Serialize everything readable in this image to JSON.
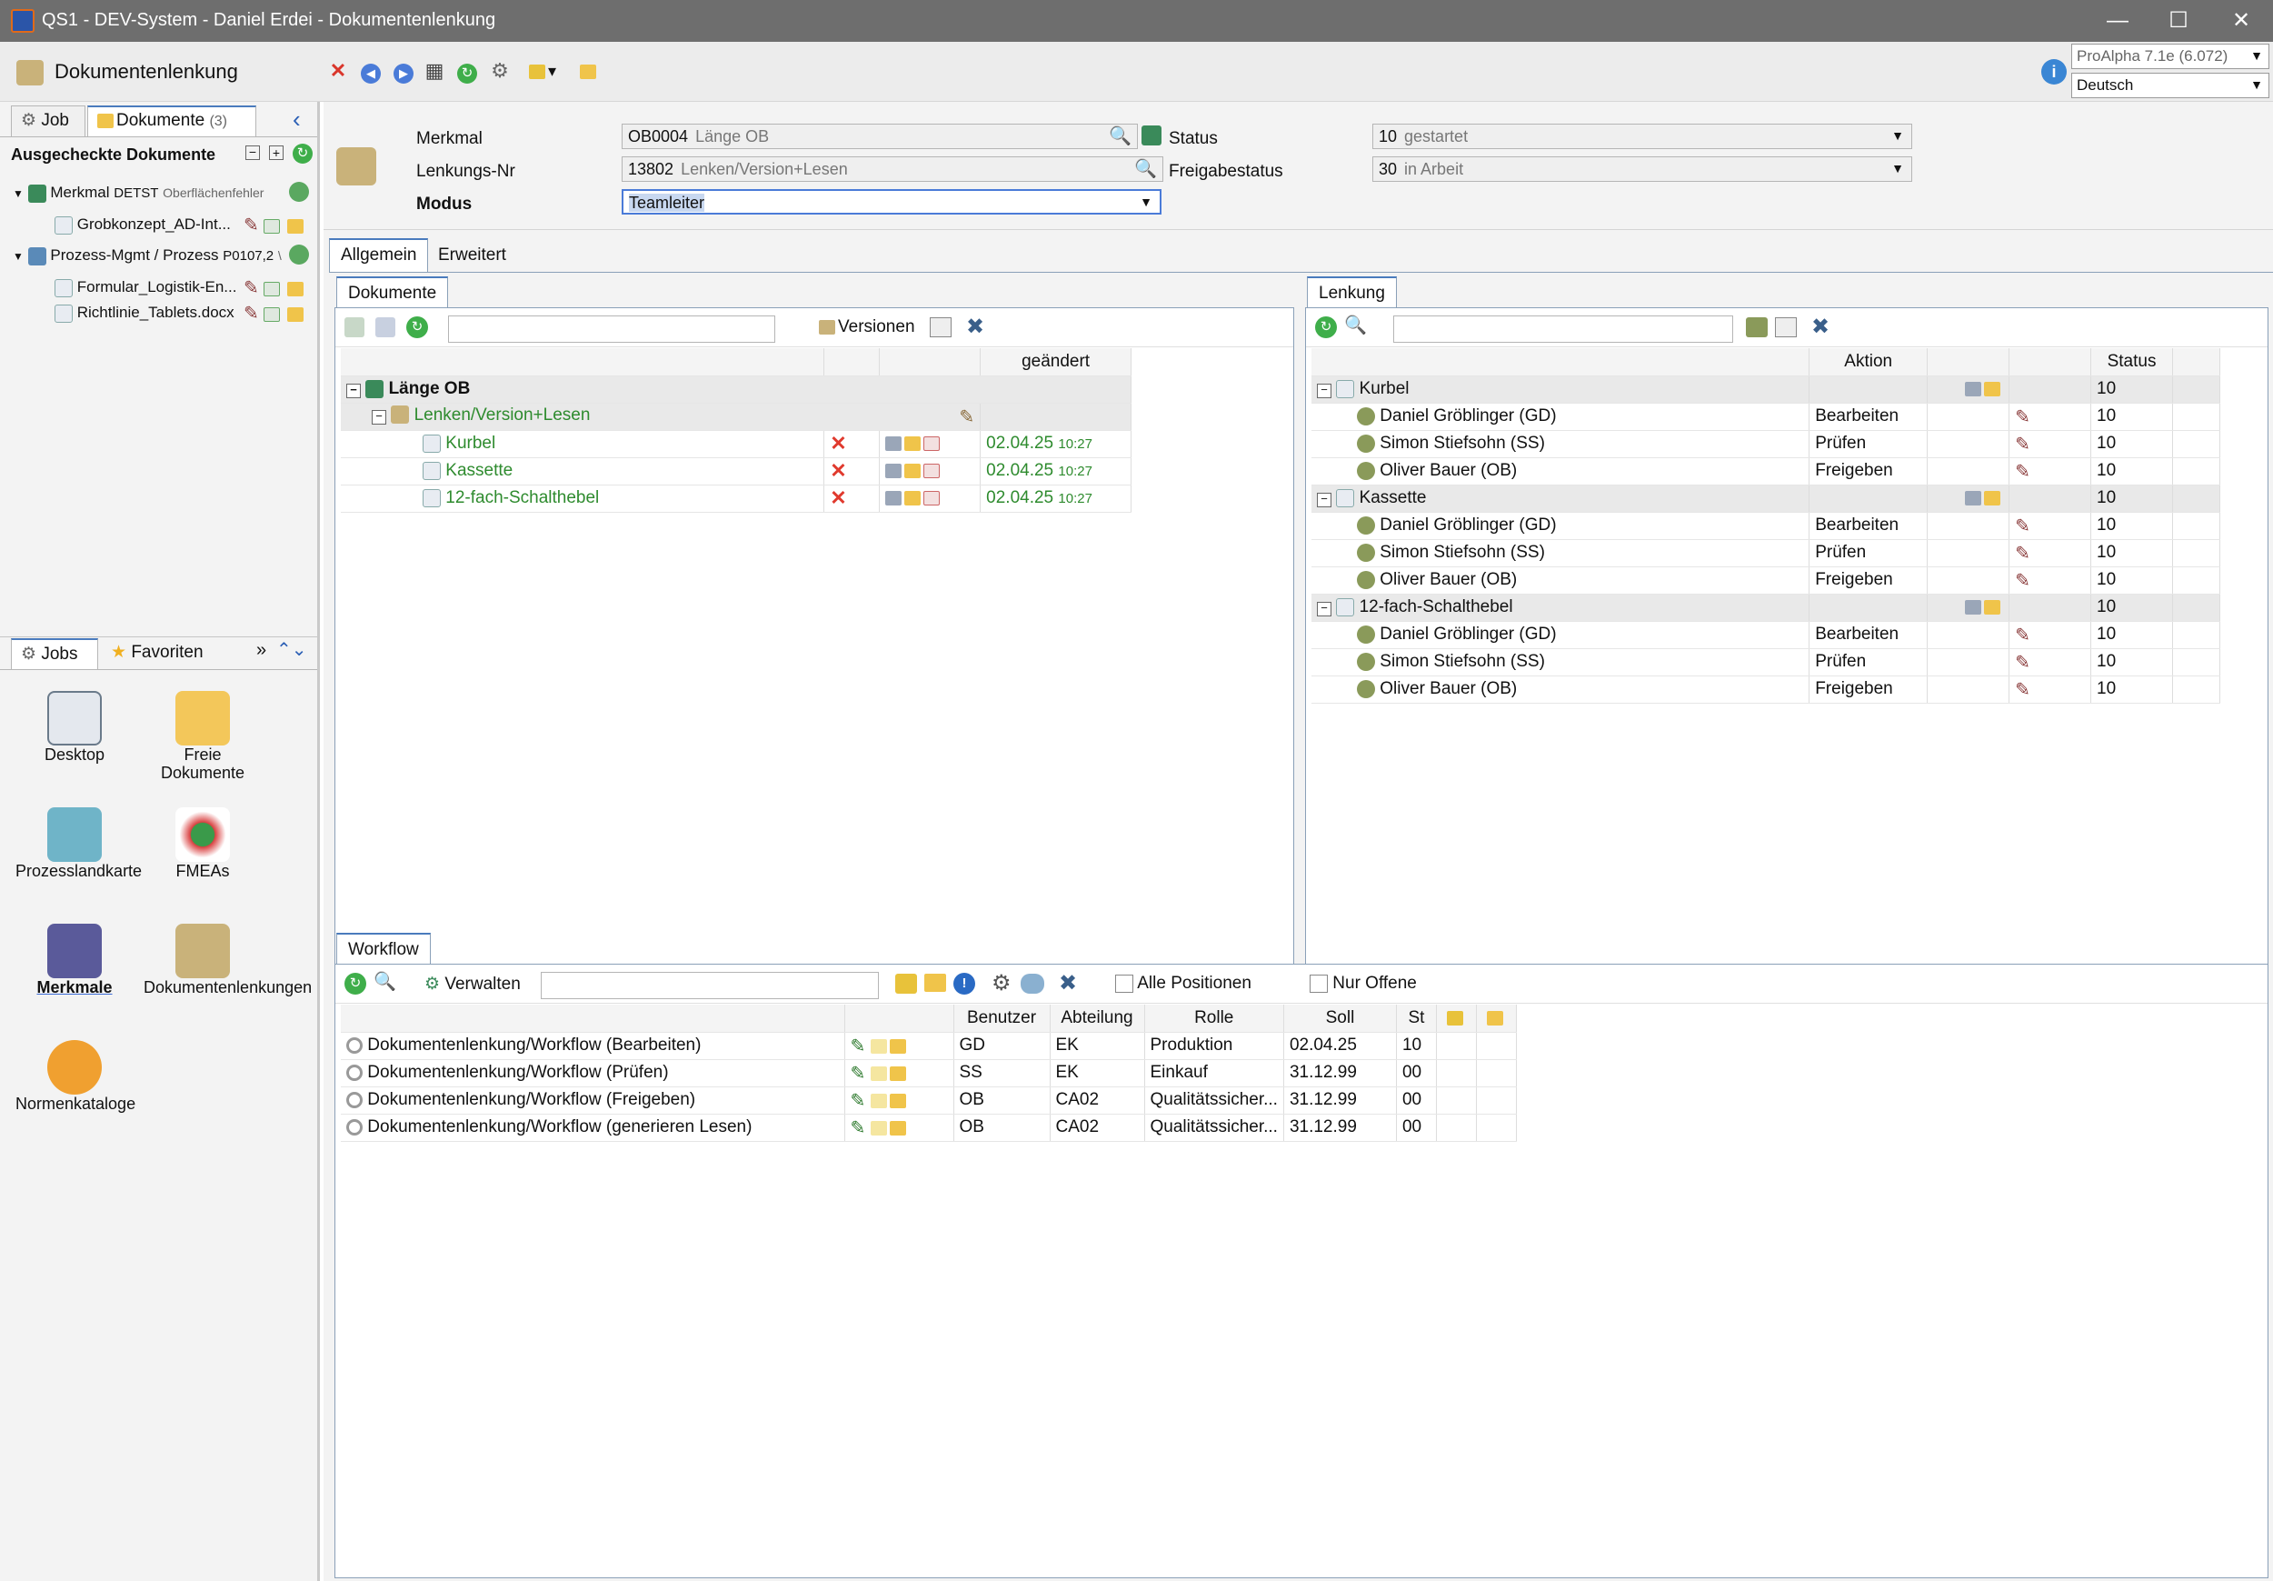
{
  "window": {
    "title": "QS1 - DEV-System - Daniel Erdei - Dokumentenlenkung"
  },
  "header": {
    "module_title": "Dokumentenlenkung",
    "version_select": "ProAlpha 7.1e (6.072)",
    "language_select": "Deutsch"
  },
  "left": {
    "tabs": [
      {
        "label": "Job"
      },
      {
        "label": "Dokumente",
        "count": "(3)"
      }
    ],
    "section_title": "Ausgecheckte Dokumente",
    "tree": [
      {
        "label": "Merkmal",
        "code": "DETST",
        "sub": "Oberflächenfehler"
      },
      {
        "label": "Grobkonzept_AD-Int..."
      },
      {
        "label": "Prozess-Mgmt / Prozess",
        "code": "P0107,2",
        "sub": "\\"
      },
      {
        "label": "Formular_Logistik-En..."
      },
      {
        "label": "Richtlinie_Tablets.docx"
      }
    ],
    "bottom_tabs": [
      {
        "label": "Jobs"
      },
      {
        "label": "Favoriten"
      }
    ],
    "jobs": [
      {
        "label": "Desktop",
        "icon": "desktop-chart-icon"
      },
      {
        "label": "Freie Dokumente",
        "icon": "folder-icon"
      },
      {
        "label": "Prozesslandkarte",
        "icon": "process-map-icon"
      },
      {
        "label": "FMEAs",
        "icon": "network-icon"
      },
      {
        "label": "Merkmale",
        "icon": "merkmale-icon"
      },
      {
        "label": "Dokumentenlenkungen",
        "icon": "doc-control-icon"
      },
      {
        "label": "Normenkataloge",
        "icon": "certificate-icon"
      }
    ]
  },
  "form": {
    "merkmal_label": "Merkmal",
    "merkmal_code": "OB0004",
    "merkmal_text": "Länge OB",
    "lenkungsnr_label": "Lenkungs-Nr",
    "lenkungsnr_code": "13802",
    "lenkungsnr_text": "Lenken/Version+Lesen",
    "modus_label": "Modus",
    "modus_value": "Teamleiter",
    "status_label": "Status",
    "status_code": "10",
    "status_text": "gestartet",
    "freigabe_label": "Freigabestatus",
    "freigabe_code": "30",
    "freigabe_text": "in Arbeit"
  },
  "main_tabs": [
    {
      "label": "Allgemein"
    },
    {
      "label": "Erweitert"
    }
  ],
  "dokumente": {
    "tab": "Dokumente",
    "versionen_label": "Versionen",
    "col_changed": "geändert",
    "root": "Länge OB",
    "lenkung": "Lenken/Version+Lesen",
    "rows": [
      {
        "name": "Kurbel",
        "date": "02.04.25",
        "time": "10:27"
      },
      {
        "name": "Kassette",
        "date": "02.04.25",
        "time": "10:27"
      },
      {
        "name": "12-fach-Schalthebel",
        "date": "02.04.25",
        "time": "10:27"
      }
    ]
  },
  "lenkung": {
    "tab": "Lenkung",
    "col_aktion": "Aktion",
    "col_status": "Status",
    "groups": [
      {
        "name": "Kurbel",
        "status": "10",
        "people": [
          {
            "name": "Daniel Gröblinger (GD)",
            "aktion": "Bearbeiten",
            "status": "10"
          },
          {
            "name": "Simon Stiefsohn (SS)",
            "aktion": "Prüfen",
            "status": "10"
          },
          {
            "name": "Oliver Bauer (OB)",
            "aktion": "Freigeben",
            "status": "10"
          }
        ]
      },
      {
        "name": "Kassette",
        "status": "10",
        "people": [
          {
            "name": "Daniel Gröblinger (GD)",
            "aktion": "Bearbeiten",
            "status": "10"
          },
          {
            "name": "Simon Stiefsohn (SS)",
            "aktion": "Prüfen",
            "status": "10"
          },
          {
            "name": "Oliver Bauer (OB)",
            "aktion": "Freigeben",
            "status": "10"
          }
        ]
      },
      {
        "name": "12-fach-Schalthebel",
        "status": "10",
        "people": [
          {
            "name": "Daniel Gröblinger (GD)",
            "aktion": "Bearbeiten",
            "status": "10"
          },
          {
            "name": "Simon Stiefsohn (SS)",
            "aktion": "Prüfen",
            "status": "10"
          },
          {
            "name": "Oliver Bauer (OB)",
            "aktion": "Freigeben",
            "status": "10"
          }
        ]
      }
    ]
  },
  "workflow": {
    "tab": "Workflow",
    "verwalten_label": "Verwalten",
    "alle_positionen": "Alle Positionen",
    "nur_offene": "Nur Offene",
    "columns": [
      "Benutzer",
      "Abteilung",
      "Rolle",
      "Soll",
      "St"
    ],
    "rows": [
      {
        "name": "Dokumentenlenkung/Workflow (Bearbeiten)",
        "benutzer": "GD",
        "abteilung": "EK",
        "rolle": "Produktion",
        "soll": "02.04.25",
        "st": "10"
      },
      {
        "name": "Dokumentenlenkung/Workflow (Prüfen)",
        "benutzer": "SS",
        "abteilung": "EK",
        "rolle": "Einkauf",
        "soll": "31.12.99",
        "st": "00"
      },
      {
        "name": "Dokumentenlenkung/Workflow (Freigeben)",
        "benutzer": "OB",
        "abteilung": "CA02",
        "rolle": "Qualitätssicher...",
        "soll": "31.12.99",
        "st": "00"
      },
      {
        "name": "Dokumentenlenkung/Workflow (generieren Lesen)",
        "benutzer": "OB",
        "abteilung": "CA02",
        "rolle": "Qualitätssicher...",
        "soll": "31.12.99",
        "st": "00"
      }
    ]
  }
}
